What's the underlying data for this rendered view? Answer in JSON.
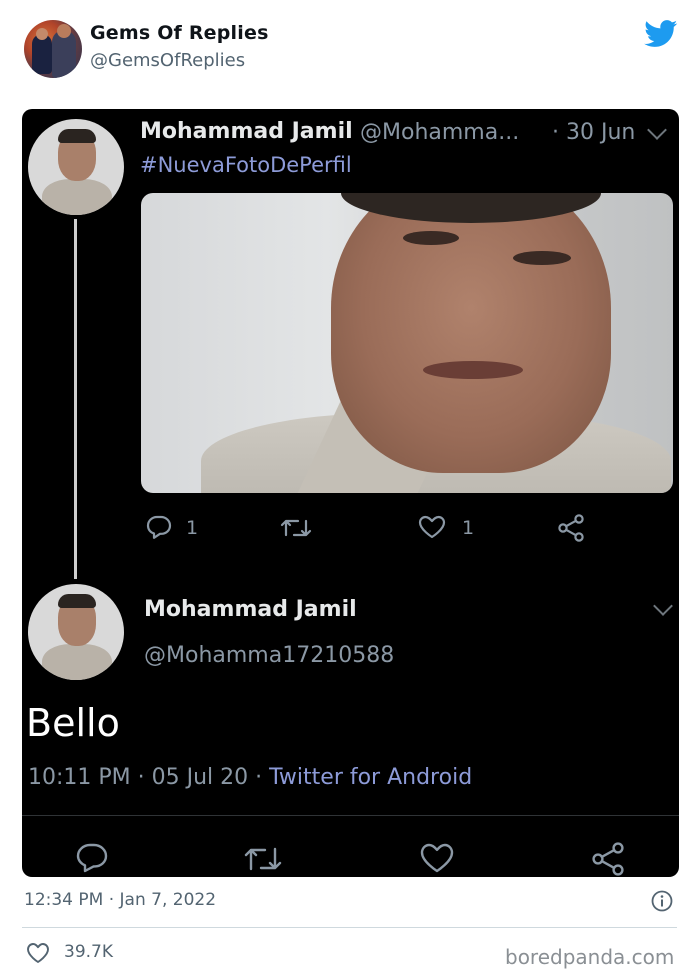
{
  "embed": {
    "name": "Gems Of Replies",
    "handle": "@GemsOfReplies",
    "timestamp": "12:34 PM · Jan 7, 2022",
    "likes": "39.7K",
    "watermark": "boredpanda.com",
    "brand_color": "#1d9bf0"
  },
  "tweet1": {
    "name": "Mohammad Jamil",
    "handle": "@Mohamma...",
    "date": "· 30 Jun",
    "hashtag": "#NuevaFotoDePerfil",
    "replies": "1",
    "likes": "1"
  },
  "tweet2": {
    "name": "Mohammad Jamil",
    "handle": "@Mohamma17210588",
    "text": "Bello",
    "meta": "10:11 PM · 05 Jul 20 · ",
    "source": "Twitter for Android"
  },
  "icons": [
    "twitter-bird-icon",
    "reply-icon",
    "retweet-icon",
    "like-icon",
    "share-icon",
    "info-icon",
    "heart-icon",
    "chevron-down-icon"
  ]
}
